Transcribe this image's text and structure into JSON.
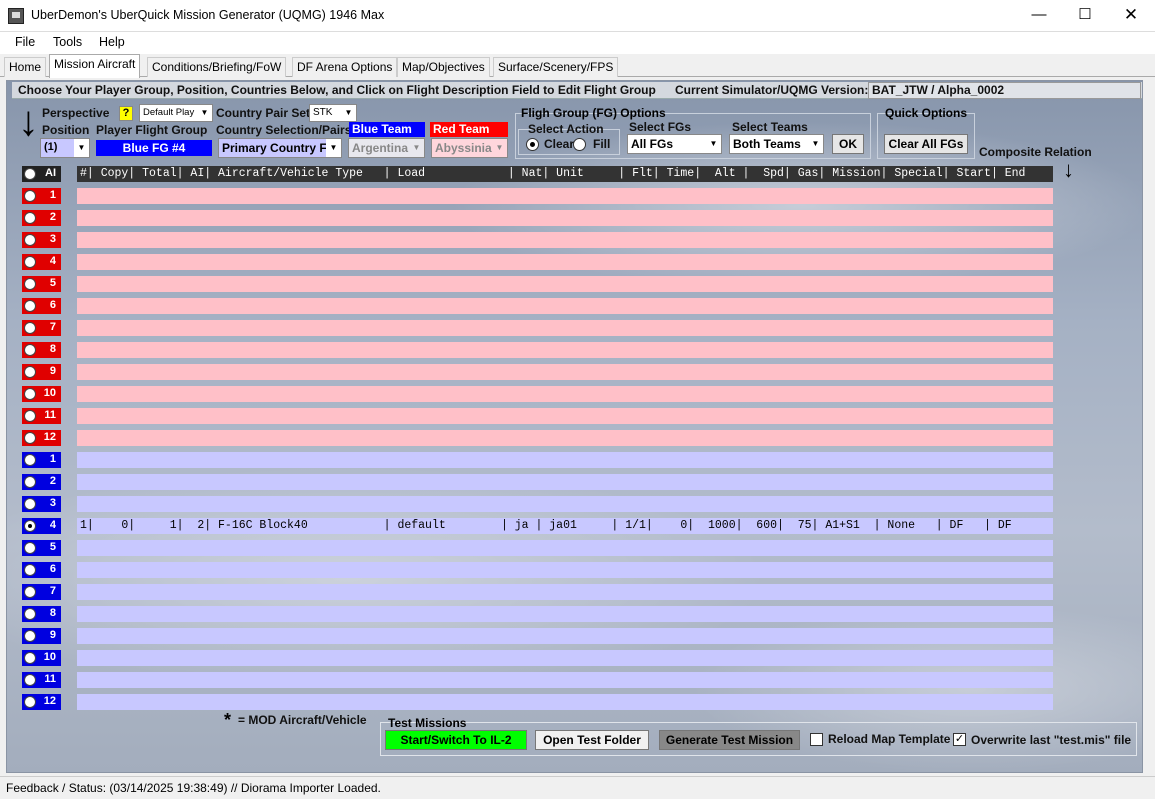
{
  "window": {
    "title": "UberDemon's UberQuick Mission Generator (UQMG) 1946 Max",
    "minimize": "—",
    "maximize": "☐",
    "close": "✕"
  },
  "menu": [
    "File",
    "Tools",
    "Help"
  ],
  "tabs": [
    "Home",
    "Mission Aircraft",
    "Conditions/Briefing/FoW",
    "DF Arena Options",
    "Map/Objectives",
    "Surface/Scenery/FPS"
  ],
  "header": {
    "instruction": "Choose Your Player Group, Position, Countries Below, and Click on Flight Description Field to Edit Flight Group",
    "version_label": "Current Simulator/UQMG Version:",
    "version_value": "BAT_JTW / Alpha_0002"
  },
  "controls": {
    "perspective_label": "Perspective",
    "help_badge": "?",
    "perspective_value": "Default Play",
    "position_label": "Position",
    "position_value": "(1)",
    "player_flight_group_label": "Player Flight Group",
    "player_flight_group_value": "Blue FG #4",
    "country_pair_set_label": "Country Pair Set",
    "country_pair_set_value": "STK",
    "country_selection_label": "Country Selection/Pairs",
    "country_selection_value": "Primary Country F",
    "blue_team_label": "Blue Team",
    "blue_team_value": "Argentina",
    "red_team_label": "Red Team",
    "red_team_value": "Abyssinia"
  },
  "fg_options": {
    "legend": "Fligh Group (FG) Options",
    "select_action_label": "Select Action",
    "clear_label": "Clear",
    "fill_label": "Fill",
    "select_fgs_label": "Select FGs",
    "select_fgs_value": "All FGs",
    "select_teams_label": "Select Teams",
    "select_teams_value": "Both Teams",
    "ok_label": "OK"
  },
  "quick_options": {
    "legend": "Quick Options",
    "clear_all_label": "Clear All FGs"
  },
  "composite_relation_label": "Composite Relation",
  "arrow_glyph": "↓",
  "table": {
    "ai_all_label": "AI",
    "column_header": "#| Copy| Total| AI| Aircraft/Vehicle Type   | Load            | Nat| Unit     | Flt| Time|  Alt |  Spd| Gas| Mission| Special| Start| End",
    "red_rows": [
      {
        "num": "1",
        "text": ""
      },
      {
        "num": "2",
        "text": ""
      },
      {
        "num": "3",
        "text": ""
      },
      {
        "num": "4",
        "text": ""
      },
      {
        "num": "5",
        "text": ""
      },
      {
        "num": "6",
        "text": ""
      },
      {
        "num": "7",
        "text": ""
      },
      {
        "num": "8",
        "text": ""
      },
      {
        "num": "9",
        "text": ""
      },
      {
        "num": "10",
        "text": ""
      },
      {
        "num": "11",
        "text": ""
      },
      {
        "num": "12",
        "text": ""
      }
    ],
    "blue_rows": [
      {
        "num": "1",
        "text": ""
      },
      {
        "num": "2",
        "text": ""
      },
      {
        "num": "3",
        "text": ""
      },
      {
        "num": "4",
        "text": "1|    0|     1|  2| F-16C Block40           | default        | ja | ja01     | 1/1|    0|  1000|  600|  75| A1+S1  | None   | DF   | DF",
        "selected": true
      },
      {
        "num": "5",
        "text": ""
      },
      {
        "num": "6",
        "text": ""
      },
      {
        "num": "7",
        "text": ""
      },
      {
        "num": "8",
        "text": ""
      },
      {
        "num": "9",
        "text": ""
      },
      {
        "num": "10",
        "text": ""
      },
      {
        "num": "11",
        "text": ""
      },
      {
        "num": "12",
        "text": ""
      }
    ]
  },
  "footer": {
    "mod_star": "*",
    "mod_note": "= MOD Aircraft/Vehicle",
    "test_missions_legend": "Test Missions",
    "start_switch_label": "Start/Switch To IL-2",
    "open_test_folder_label": "Open Test Folder",
    "generate_label": "Generate Test Mission",
    "reload_map_label": "Reload Map Template",
    "reload_map_checked": false,
    "overwrite_label": "Overwrite last \"test.mis\" file",
    "overwrite_checked": true
  },
  "status": {
    "text": "Feedback / Status:  (03/14/2025 19:38:49) // Diorama Importer Loaded."
  },
  "colors": {
    "red_button": "#e00000",
    "blue_button": "#0000e0",
    "red_row": "#ffc0c8",
    "blue_row": "#c8c8ff",
    "start_button": "#00ff00",
    "generate_button": "#888888"
  }
}
